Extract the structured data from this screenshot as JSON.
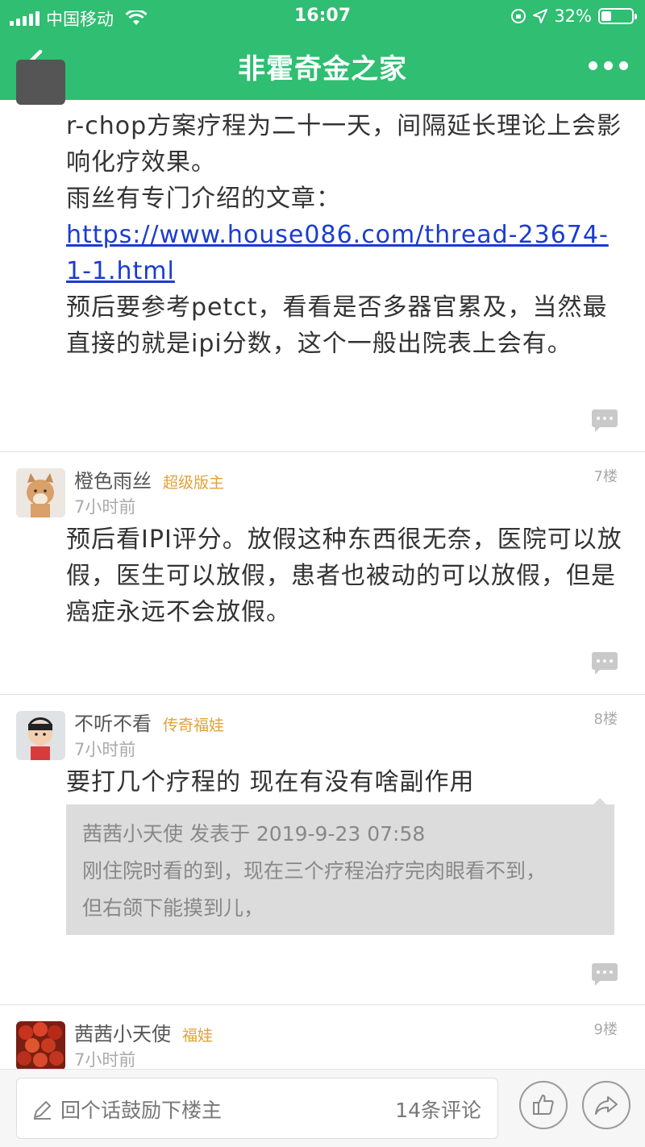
{
  "status_bar": {
    "carrier": "中国移动",
    "time": "16:07",
    "battery": "32%"
  },
  "nav": {
    "title": "非霍奇金之家"
  },
  "posts": [
    {
      "paragraphs": [
        "r-chop方案疗程为二十一天，间隔延长理论上会影响化疗效果。",
        "雨丝有专门介绍的文章："
      ],
      "link": "https://www.house086.com/thread-23674-1-1.html",
      "after_link": "预后要参考petct，看看是否多器官累及，当然最直接的就是ipi分数，这个一般出院表上会有。"
    },
    {
      "username": "橙色雨丝",
      "badge": "超级版主",
      "time": "7小时前",
      "floor": "7楼",
      "text": "预后看IPI评分。放假这种东西很无奈，医院可以放假，医生可以放假，患者也被动的可以放假，但是癌症永远不会放假。"
    },
    {
      "username": "不听不看",
      "badge": "传奇福娃",
      "time": "7小时前",
      "floor": "8楼",
      "text": "要打几个疗程的  现在有没有啥副作用",
      "quote": {
        "header": "茜茜小天使 发表于 2019-9-23 07:58",
        "line1": "刚住院时看的到，现在三个疗程治疗完肉眼看不到，",
        "line2": "但右颌下能摸到儿，"
      }
    },
    {
      "username": "茜茜小天使",
      "badge": "福娃",
      "time": "7小时前",
      "floor": "9楼"
    }
  ],
  "bottom_bar": {
    "placeholder": "回个话鼓励下楼主",
    "comment_count": "14条评论"
  },
  "colors": {
    "header_green": "#2fbe72",
    "link_blue": "#1a3ccf",
    "badge_orange": "#e2a13b"
  }
}
